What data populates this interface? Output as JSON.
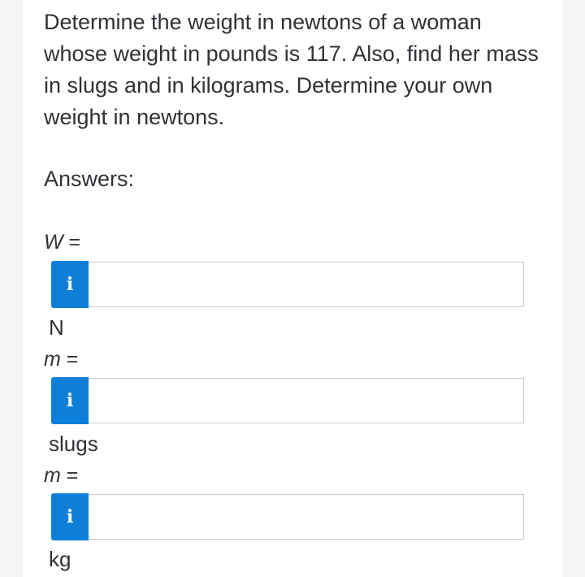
{
  "question": "Determine the weight in newtons of a woman whose weight in pounds is 117. Also, find her mass in slugs and in kilograms. Determine your own weight in newtons.",
  "answers_label": "Answers:",
  "fields": [
    {
      "symbol": "W",
      "equals": " =",
      "info_icon": "i",
      "value": "",
      "unit": "N"
    },
    {
      "symbol": "m",
      "equals": " =",
      "info_icon": "i",
      "value": "",
      "unit": "slugs"
    },
    {
      "symbol": "m",
      "equals": " =",
      "info_icon": "i",
      "value": "",
      "unit": "kg"
    }
  ],
  "colors": {
    "info_button": "#0d7fd9",
    "input_border": "#c9ccd1"
  }
}
